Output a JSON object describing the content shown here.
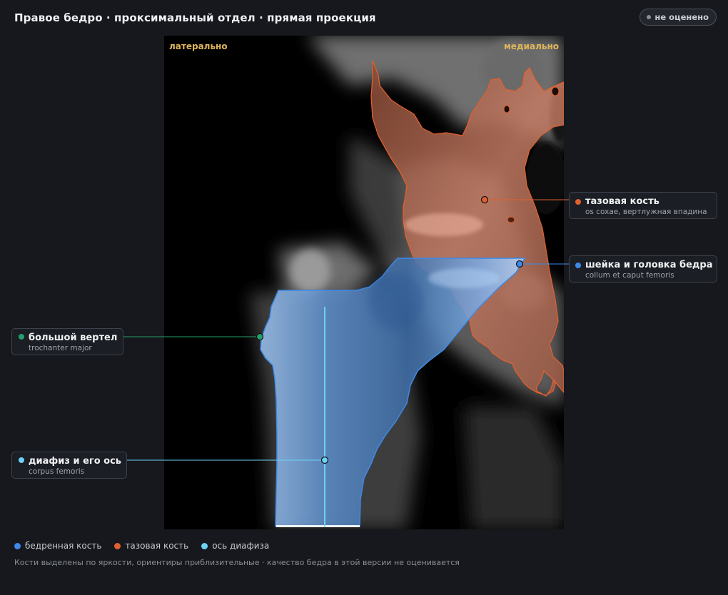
{
  "header": {
    "title": "Правое бедро · проксимальный отдел · прямая проекция",
    "status": "не оценено"
  },
  "viewer": {
    "lateral_label": "латерально",
    "medial_label": "медиально"
  },
  "callouts": {
    "pelvis": {
      "name": "тазовая кость",
      "sub": "os coxae, вертлужная впадина",
      "color": "#e0602e"
    },
    "neck": {
      "name": "шейка и головка бедра",
      "sub": "collum et caput femoris",
      "color": "#3d8ae8"
    },
    "trochanter": {
      "name": "большой вертел",
      "sub": "trochanter major",
      "color": "#22a06b"
    },
    "shaft": {
      "name": "диафиз и его ось",
      "sub": "corpus femoris",
      "color": "#6cd2f5"
    }
  },
  "legend": [
    {
      "label": "бедренная кость",
      "color": "#3d8ae8"
    },
    {
      "label": "тазовая кость",
      "color": "#e0602e"
    },
    {
      "label": "ось диафиза",
      "color": "#6cd2f5"
    }
  ],
  "footnote": "Кости выделены по яркости, ориентиры приблизительные · качество бедра в этой версии не оценивается"
}
